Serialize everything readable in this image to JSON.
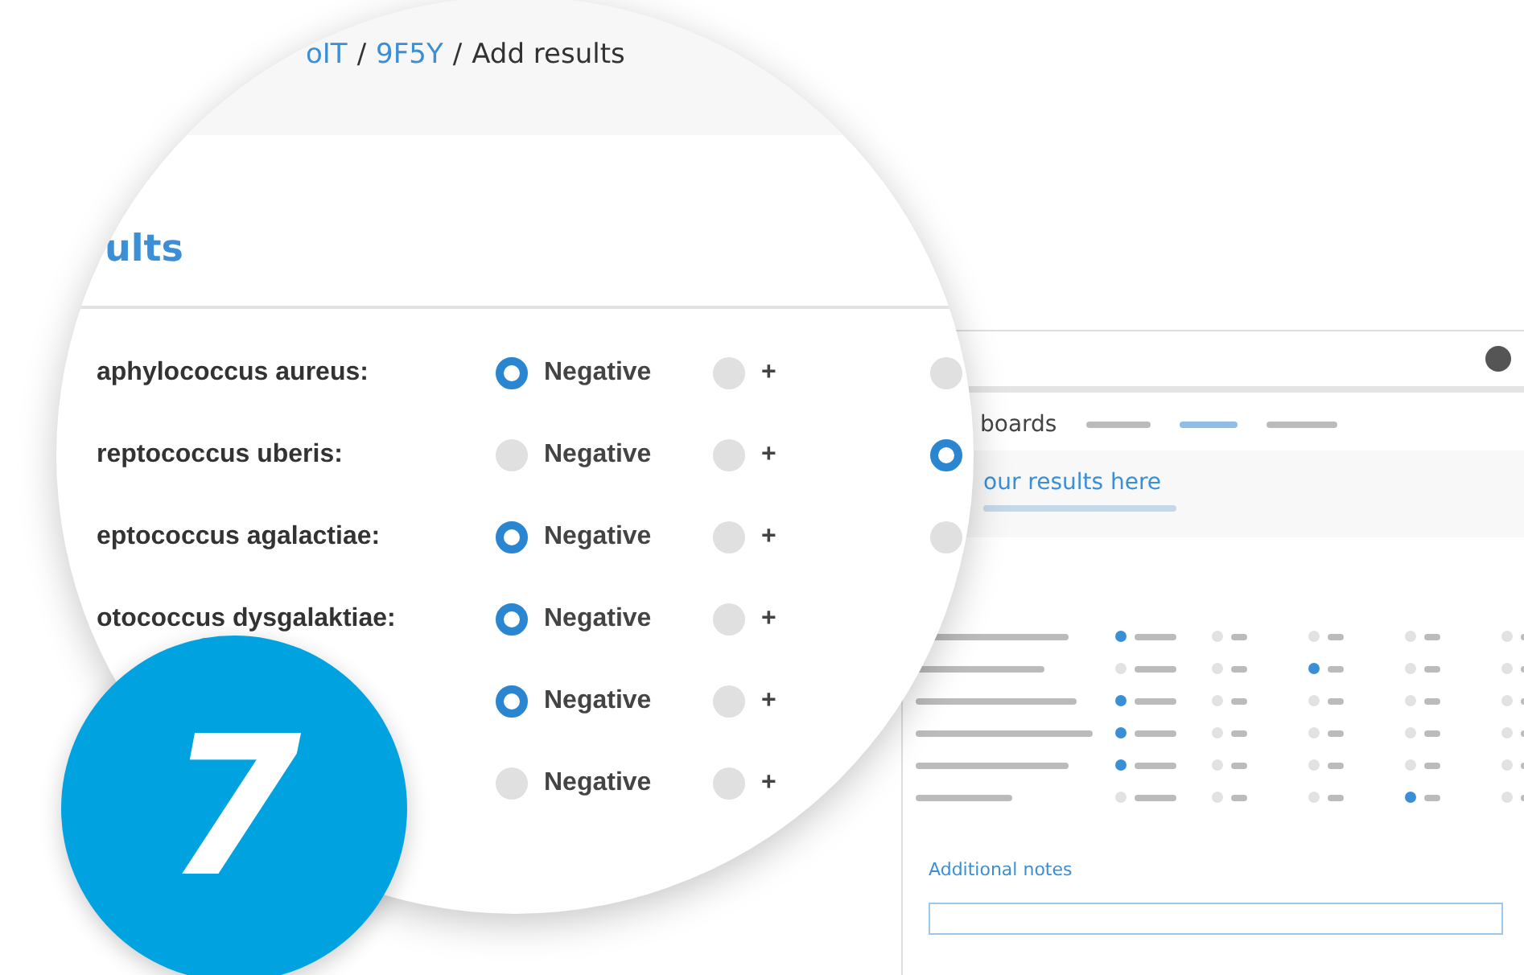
{
  "background_window": {
    "logo": "boards",
    "title": "our results here",
    "notes_heading": "Additional notes",
    "rows": [
      {
        "options": [
          {
            "selected": true
          },
          {
            "selected": false
          },
          {
            "selected": false
          },
          {
            "selected": false
          },
          {
            "selected": false
          }
        ]
      },
      {
        "options": [
          {
            "selected": false
          },
          {
            "selected": false
          },
          {
            "selected": true
          },
          {
            "selected": false
          },
          {
            "selected": false
          }
        ]
      },
      {
        "options": [
          {
            "selected": true
          },
          {
            "selected": false
          },
          {
            "selected": false
          },
          {
            "selected": false
          },
          {
            "selected": false
          }
        ]
      },
      {
        "options": [
          {
            "selected": true
          },
          {
            "selected": false
          },
          {
            "selected": false
          },
          {
            "selected": false
          },
          {
            "selected": false
          }
        ]
      },
      {
        "options": [
          {
            "selected": true
          },
          {
            "selected": false
          },
          {
            "selected": false
          },
          {
            "selected": false
          },
          {
            "selected": false
          }
        ]
      },
      {
        "options": [
          {
            "selected": false
          },
          {
            "selected": false
          },
          {
            "selected": false
          },
          {
            "selected": true
          },
          {
            "selected": false
          }
        ]
      }
    ]
  },
  "magnifier": {
    "breadcrumb_separator": "/",
    "breadcrumb": [
      {
        "label": "oIT",
        "link": true
      },
      {
        "label": "9F5Y",
        "link": true
      },
      {
        "label": "Add results",
        "link": false
      }
    ],
    "heading": "ults",
    "rows": [
      {
        "label": "aphylococcus aureus:",
        "options": [
          {
            "label": "Negative",
            "selected": true
          },
          {
            "label": "+",
            "selected": false
          },
          {
            "selected": false
          }
        ]
      },
      {
        "label": "reptococcus uberis:",
        "options": [
          {
            "label": "Negative",
            "selected": false
          },
          {
            "label": "+",
            "selected": false
          },
          {
            "selected": true
          }
        ]
      },
      {
        "label": "eptococcus agalactiae:",
        "options": [
          {
            "label": "Negative",
            "selected": true
          },
          {
            "label": "+",
            "selected": false
          },
          {
            "selected": false
          }
        ]
      },
      {
        "label": "otococcus dysgalaktiae:",
        "options": [
          {
            "label": "Negative",
            "selected": true
          },
          {
            "label": "+",
            "selected": false
          }
        ]
      },
      {
        "options": [
          {
            "label": "Negative",
            "selected": true
          },
          {
            "label": "+",
            "selected": false
          }
        ]
      },
      {
        "options": [
          {
            "label": "Negative",
            "selected": false
          },
          {
            "label": "+",
            "selected": false
          }
        ]
      }
    ]
  },
  "step_badge": "7"
}
